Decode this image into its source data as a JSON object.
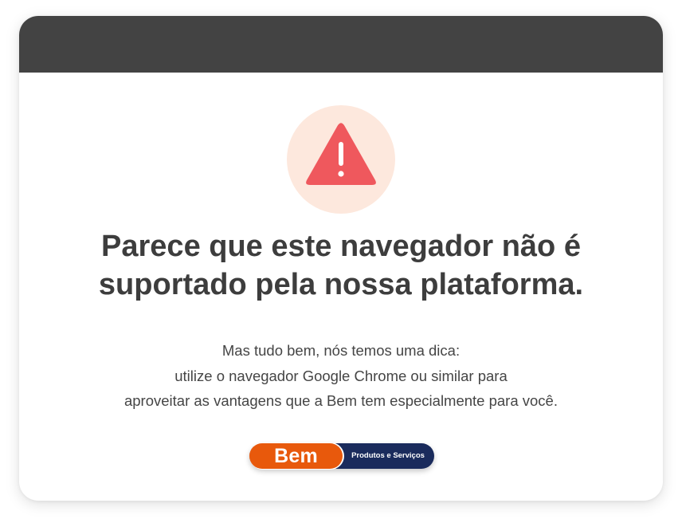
{
  "colors": {
    "header": "#434343",
    "warning_icon": "#ef585d",
    "warning_circle": "#fde8dd",
    "text": "#3d3d3d",
    "brand_orange": "#e8590c",
    "brand_navy": "#1a2b5c"
  },
  "alert": {
    "icon": "warning-triangle-icon",
    "title_lines": [
      "Parece que este navegador não é",
      "suportado pela nossa plataforma."
    ],
    "message_lines": [
      "Mas tudo bem, nós temos uma dica:",
      "utilize o navegador Google Chrome ou similar para",
      "aproveitar as vantagens que a Bem tem especialmente para você."
    ]
  },
  "brand": {
    "name": "Bem",
    "tagline": "Produtos e Serviços"
  }
}
